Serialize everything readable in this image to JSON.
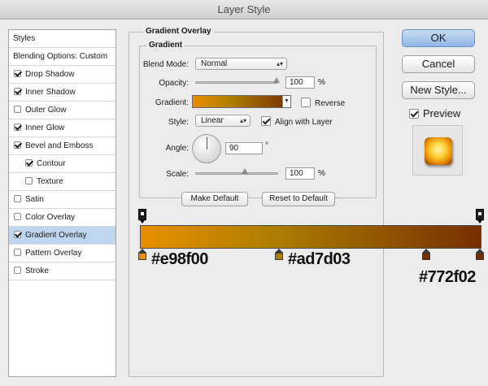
{
  "window": {
    "title": "Layer Style"
  },
  "styles_panel": {
    "header": "Styles",
    "items": [
      {
        "label": "Blending Options: Custom",
        "has_checkbox": false,
        "checked": false,
        "selected": false,
        "indent": false
      },
      {
        "label": "Drop Shadow",
        "has_checkbox": true,
        "checked": true,
        "selected": false,
        "indent": false
      },
      {
        "label": "Inner Shadow",
        "has_checkbox": true,
        "checked": true,
        "selected": false,
        "indent": false
      },
      {
        "label": "Outer Glow",
        "has_checkbox": true,
        "checked": false,
        "selected": false,
        "indent": false
      },
      {
        "label": "Inner Glow",
        "has_checkbox": true,
        "checked": true,
        "selected": false,
        "indent": false
      },
      {
        "label": "Bevel and Emboss",
        "has_checkbox": true,
        "checked": true,
        "selected": false,
        "indent": false
      },
      {
        "label": "Contour",
        "has_checkbox": true,
        "checked": true,
        "selected": false,
        "indent": true
      },
      {
        "label": "Texture",
        "has_checkbox": true,
        "checked": false,
        "selected": false,
        "indent": true
      },
      {
        "label": "Satin",
        "has_checkbox": true,
        "checked": false,
        "selected": false,
        "indent": false
      },
      {
        "label": "Color Overlay",
        "has_checkbox": true,
        "checked": false,
        "selected": false,
        "indent": false
      },
      {
        "label": "Gradient Overlay",
        "has_checkbox": true,
        "checked": true,
        "selected": true,
        "indent": false
      },
      {
        "label": "Pattern Overlay",
        "has_checkbox": true,
        "checked": false,
        "selected": false,
        "indent": false
      },
      {
        "label": "Stroke",
        "has_checkbox": true,
        "checked": false,
        "selected": false,
        "indent": false
      }
    ]
  },
  "gradient_overlay": {
    "section_title": "Gradient Overlay",
    "group_title": "Gradient",
    "blend_mode": {
      "label": "Blend Mode:",
      "value": "Normal"
    },
    "opacity": {
      "label": "Opacity:",
      "value": "100",
      "unit": "%",
      "level": 1.0
    },
    "gradient": {
      "label": "Gradient:",
      "reverse_label": "Reverse",
      "reverse_checked": false
    },
    "style": {
      "label": "Style:",
      "value": "Linear",
      "align_label": "Align with Layer",
      "align_checked": true
    },
    "angle": {
      "label": "Angle:",
      "value": "90",
      "unit": "°"
    },
    "scale": {
      "label": "Scale:",
      "value": "100",
      "unit": "%",
      "level": 0.5
    },
    "make_default": "Make Default",
    "reset_default": "Reset to Default"
  },
  "gradient_editor": {
    "colors": {
      "start": "#e98f00",
      "mid": "#ad7d03",
      "end": "#772f02"
    },
    "stop_labels": [
      "#e98f00",
      "#ad7d03",
      "#772f02"
    ]
  },
  "actions": {
    "ok": "OK",
    "cancel": "Cancel",
    "new_style": "New Style...",
    "preview_label": "Preview",
    "preview_checked": true
  },
  "icons": {
    "dropdown": "chevron-up-down-icon",
    "checkmark": "check-icon",
    "angle_dial": "angle-dial-icon",
    "color_stop": "color-stop-icon",
    "opacity_stop": "opacity-stop-icon"
  }
}
